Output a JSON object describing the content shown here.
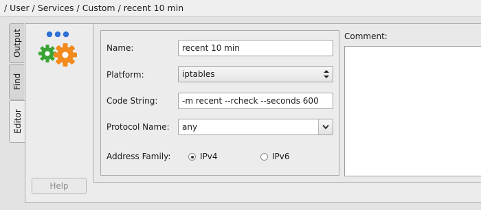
{
  "breadcrumb": "/ User / Services / Custom / recent 10 min",
  "side_tabs": [
    {
      "label": "Output"
    },
    {
      "label": "Find"
    },
    {
      "label": "Editor",
      "active": true
    }
  ],
  "form": {
    "name_label": "Name:",
    "name_value": "recent 10 min",
    "platform_label": "Platform:",
    "platform_value": "iptables",
    "code_label": "Code String:",
    "code_value": "-m recent  --rcheck --seconds 600",
    "protocol_label": "Protocol Name:",
    "protocol_value": "any",
    "family_label": "Address Family:",
    "ipv4_label": "IPv4",
    "ipv6_label": "IPv6",
    "selected_family": "IPv4"
  },
  "comment": {
    "label": "Comment:",
    "value": ""
  },
  "help_button": "Help",
  "colors": {
    "gear_green": "#3aa435",
    "gear_orange": "#f28a1d",
    "dots_blue": "#2e6fd8"
  },
  "icons": {
    "logo": "gears-logo-icon"
  }
}
